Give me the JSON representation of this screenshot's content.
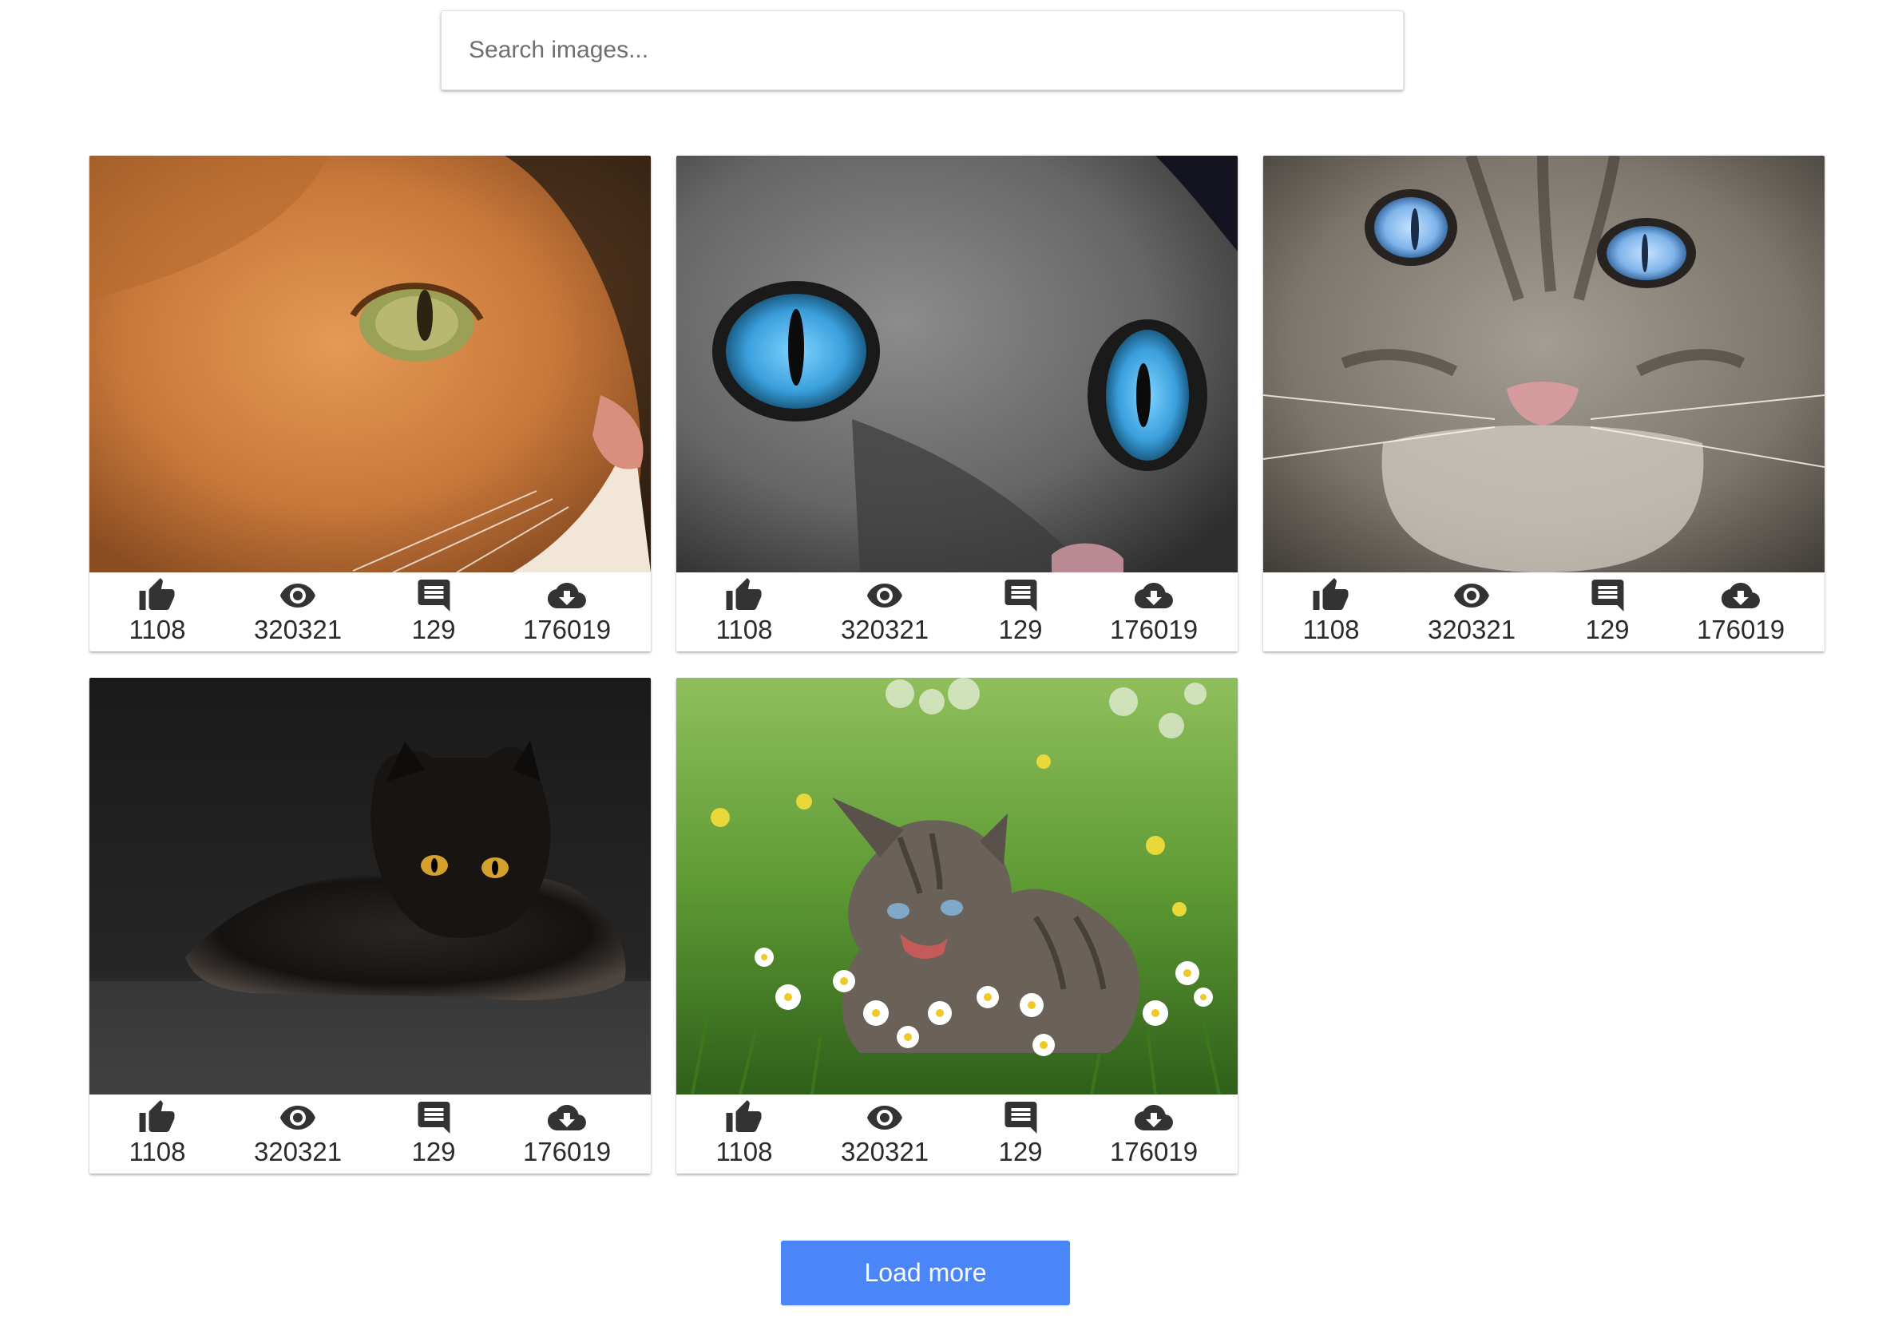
{
  "search": {
    "placeholder": "Search images...",
    "value": ""
  },
  "cards": [
    {
      "image": "orange tabby cat close-up",
      "likes": "1108",
      "views": "320321",
      "comments": "129",
      "downloads": "176019"
    },
    {
      "image": "grey cat with blue eyes close-up",
      "likes": "1108",
      "views": "320321",
      "comments": "129",
      "downloads": "176019"
    },
    {
      "image": "grey tabby cat with blue eyes",
      "likes": "1108",
      "views": "320321",
      "comments": "129",
      "downloads": "176019"
    },
    {
      "image": "black cat on dark background",
      "likes": "1108",
      "views": "320321",
      "comments": "129",
      "downloads": "176019"
    },
    {
      "image": "tabby kitten in daisy meadow",
      "likes": "1108",
      "views": "320321",
      "comments": "129",
      "downloads": "176019"
    }
  ],
  "load_more_label": "Load more",
  "colors": {
    "accent": "#4a86f7",
    "icon": "#333333",
    "text": "#2b2b2b"
  },
  "icons": {
    "likes": "thumb-up-icon",
    "views": "eye-icon",
    "comments": "comment-icon",
    "downloads": "cloud-download-icon"
  }
}
